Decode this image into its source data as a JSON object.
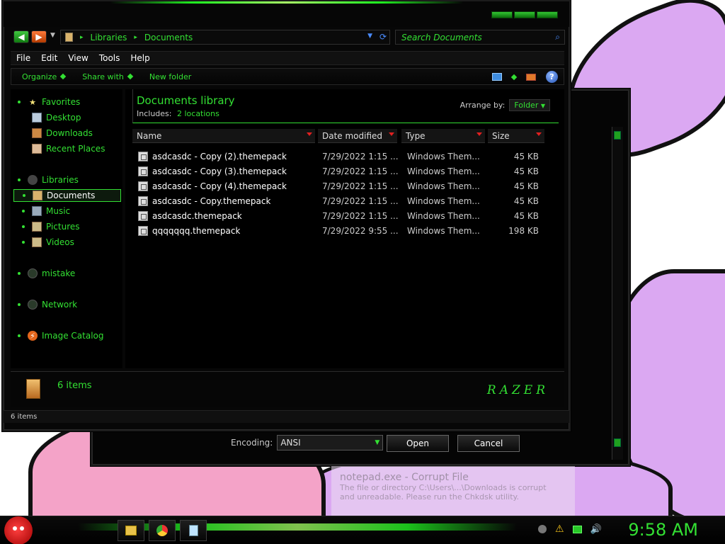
{
  "address": {
    "crumbs": [
      "Libraries",
      "Documents"
    ]
  },
  "search": {
    "placeholder": "Search Documents"
  },
  "menu": [
    "File",
    "Edit",
    "View",
    "Tools",
    "Help"
  ],
  "toolbar": {
    "organize": "Organize",
    "share_with": "Share with",
    "new_folder": "New folder",
    "help": "?"
  },
  "nav": {
    "favorites": "Favorites",
    "desktop": "Desktop",
    "downloads": "Downloads",
    "recent_places": "Recent Places",
    "libraries": "Libraries",
    "documents": "Documents",
    "music": "Music",
    "pictures": "Pictures",
    "videos": "Videos",
    "mistake": "mistake",
    "network": "Network",
    "image_catalog": "Image Catalog"
  },
  "library": {
    "title": "Documents library",
    "includes_label": "Includes:",
    "includes_link": "2 locations",
    "arrange_label": "Arrange by:",
    "arrange_value": "Folder"
  },
  "columns": {
    "name": "Name",
    "date": "Date modified",
    "type": "Type",
    "size": "Size"
  },
  "files": [
    {
      "name": "asdcasdc - Copy (2).themepack",
      "date": "7/29/2022 1:15 ...",
      "type": "Windows Them...",
      "size": "45 KB"
    },
    {
      "name": "asdcasdc - Copy (3).themepack",
      "date": "7/29/2022 1:15 ...",
      "type": "Windows Them...",
      "size": "45 KB"
    },
    {
      "name": "asdcasdc - Copy (4).themepack",
      "date": "7/29/2022 1:15 ...",
      "type": "Windows Them...",
      "size": "45 KB"
    },
    {
      "name": "asdcasdc - Copy.themepack",
      "date": "7/29/2022 1:15 ...",
      "type": "Windows Them...",
      "size": "45 KB"
    },
    {
      "name": "asdcasdc.themepack",
      "date": "7/29/2022 1:15 ...",
      "type": "Windows Them...",
      "size": "45 KB"
    },
    {
      "name": "qqqqqqq.themepack",
      "date": "7/29/2022 9:55 ...",
      "type": "Windows Them...",
      "size": "198 KB"
    }
  ],
  "details": {
    "count": "6 items",
    "brand": "RAZER"
  },
  "status": {
    "text": "6 items"
  },
  "dialog": {
    "encoding_label": "Encoding:",
    "encoding_value": "ANSI",
    "open": "Open",
    "cancel": "Cancel"
  },
  "notification": {
    "title": "notepad.exe - Corrupt File",
    "body_line1": "The file or directory C:\\Users\\...\\Downloads is corrupt",
    "body_line2": "and unreadable. Please run the Chkdsk utility."
  },
  "clock": {
    "time": "9:58 AM"
  },
  "colors": {
    "accent": "#33e033",
    "window_bg": "#070707",
    "wallpaper_purple": "#d9a6f0",
    "wallpaper_pink": "#f2a0c4"
  }
}
